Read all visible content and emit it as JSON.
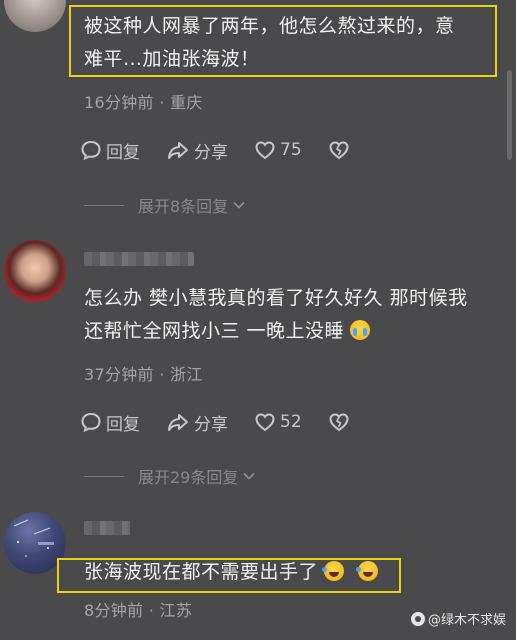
{
  "comments": [
    {
      "text_line1": "被这种人网暴了两年，他怎么熬过来的，意",
      "text_line2": "难平…加油张海波！",
      "meta": "16分钟前 · 重庆",
      "reply_label": "回复",
      "share_label": "分享",
      "like_count": "75",
      "expand_label": "展开8条回复"
    },
    {
      "text_line1": "怎么办 樊小慧我真的看了好久好久 那时候我",
      "text_line2": "还帮忙全网找小三 一晚上没睡",
      "emoji": "loudly-crying-face",
      "meta": "37分钟前 · 浙江",
      "reply_label": "回复",
      "share_label": "分享",
      "like_count": "52",
      "expand_label": "展开29条回复"
    },
    {
      "text_line1": "张海波现在都不需要出手了",
      "emojis": [
        "rolling-on-floor-laughing",
        "rolling-on-floor-laughing"
      ],
      "meta": "8分钟前 · 江苏"
    }
  ],
  "watermark": "@绿木不求娱",
  "colors": {
    "background": "#4a4a4c",
    "highlight_box": "#f0d012",
    "meta_text": "#a5a5a7"
  },
  "icons": [
    "comment-bubble-icon",
    "share-arrow-icon",
    "heart-icon",
    "broken-heart-icon",
    "chevron-down-icon"
  ]
}
